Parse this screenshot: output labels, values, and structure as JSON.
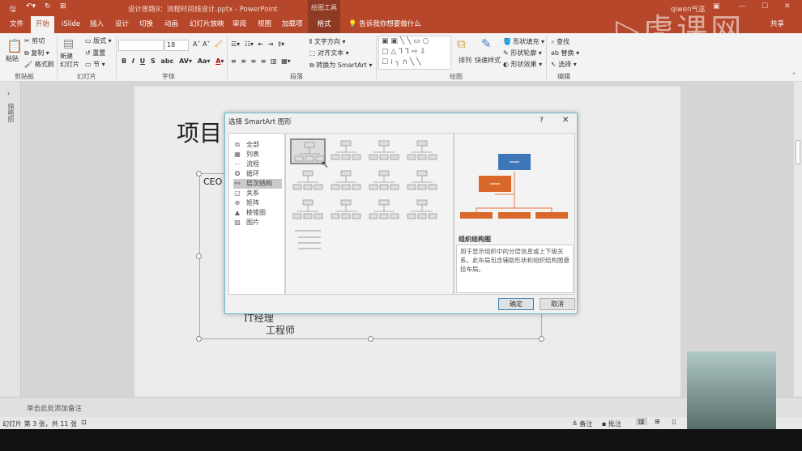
{
  "window": {
    "title": "设计思路9：流程时间线设计.pptx - PowerPoint",
    "context_tab_group": "绘图工具",
    "user": "qiwen气温",
    "share": "共享",
    "watermark": "虎课网"
  },
  "tabs": [
    "文件",
    "开始",
    "iSlide",
    "插入",
    "设计",
    "切换",
    "动画",
    "幻灯片放映",
    "审阅",
    "视图",
    "加载项",
    "格式"
  ],
  "tell_me": "告诉我你想要做什么",
  "ribbon": {
    "clipboard": {
      "label": "剪贴板",
      "paste": "粘贴",
      "cut": "剪切",
      "copy": "复制",
      "format_painter": "格式刷"
    },
    "slides": {
      "label": "幻灯片",
      "new_slide": "新建\n幻灯片",
      "layout": "版式",
      "reset": "重置",
      "section": "节"
    },
    "font": {
      "label": "字体",
      "font_name": "",
      "font_size": "18"
    },
    "paragraph": {
      "label": "段落",
      "text_direction": "文字方向",
      "align_text": "对齐文本",
      "convert_smartart": "转换为 SmartArt"
    },
    "drawing": {
      "label": "绘图",
      "arrange": "排列",
      "quick_styles": "快速样式",
      "shape_fill": "形状填充",
      "shape_outline": "形状轮廓",
      "shape_effects": "形状效果"
    },
    "editing": {
      "label": "编辑",
      "find": "查找",
      "replace": "替换",
      "select": "选择"
    }
  },
  "left_panel": {
    "label": "缩略图"
  },
  "slide": {
    "title": "项目",
    "lines": [
      "CEO",
      "IT经理",
      "工程师"
    ]
  },
  "dialog": {
    "title": "选择 SmartArt 图形",
    "help": "?",
    "categories": [
      {
        "label": "全部",
        "icon": "all"
      },
      {
        "label": "列表",
        "icon": "list"
      },
      {
        "label": "流程",
        "icon": "process"
      },
      {
        "label": "循环",
        "icon": "cycle"
      },
      {
        "label": "层次结构",
        "icon": "hierarchy",
        "selected": true
      },
      {
        "label": "关系",
        "icon": "relationship"
      },
      {
        "label": "矩阵",
        "icon": "matrix"
      },
      {
        "label": "棱锥图",
        "icon": "pyramid"
      },
      {
        "label": "图片",
        "icon": "picture"
      }
    ],
    "preview_title": "组织结构图",
    "preview_desc": "用于显示组织中的分层信息或上下级关系。此布局包含辅助形状和组织结构图悬挂布局。",
    "ok": "确定",
    "cancel": "取消",
    "colors": {
      "top": "#3e77b8",
      "child": "#d9692a"
    }
  },
  "notes": {
    "placeholder": "单击此处添加备注"
  },
  "status": {
    "slide_info": "幻灯片 第 3 张，共 11 张",
    "notes": "备注",
    "comments": "批注"
  }
}
